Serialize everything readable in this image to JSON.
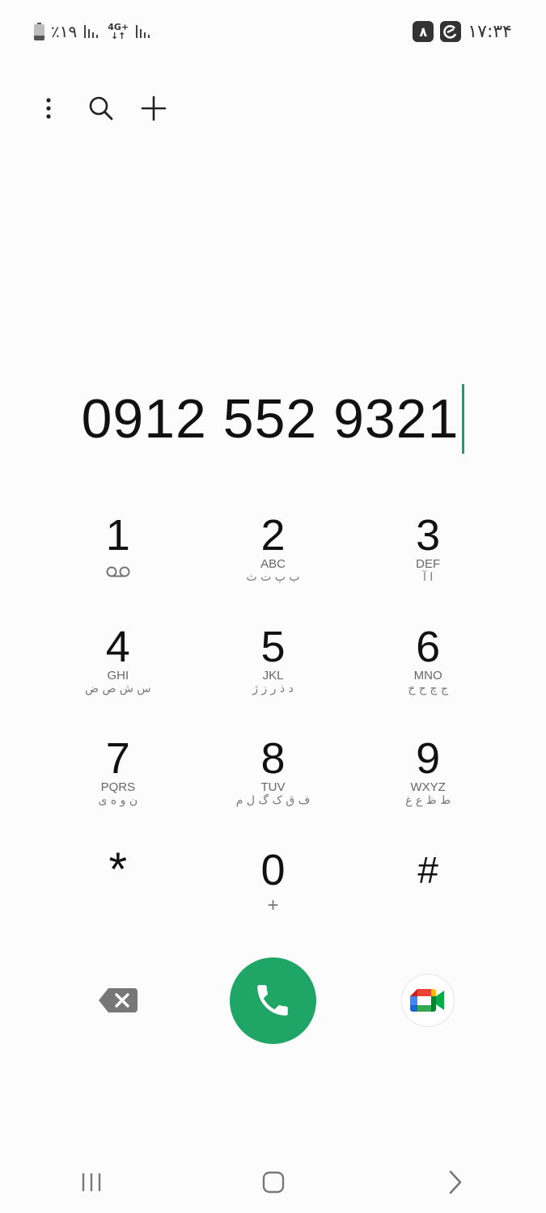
{
  "status_bar": {
    "battery_percent": "٪۱۹",
    "network_type": "4G+",
    "time": "۱۷:۳۴",
    "notification_count": "۸"
  },
  "dialer": {
    "number": "0912 552 9321",
    "keys": [
      {
        "digit": "1",
        "letters": "",
        "persian": ""
      },
      {
        "digit": "2",
        "letters": "ABC",
        "persian": "ب پ ت ث"
      },
      {
        "digit": "3",
        "letters": "DEF",
        "persian": "ا آ"
      },
      {
        "digit": "4",
        "letters": "GHI",
        "persian": "س ش ص ض"
      },
      {
        "digit": "5",
        "letters": "JKL",
        "persian": "د ذ ر ز ژ"
      },
      {
        "digit": "6",
        "letters": "MNO",
        "persian": "ج چ ح خ"
      },
      {
        "digit": "7",
        "letters": "PQRS",
        "persian": "ن و ه ی"
      },
      {
        "digit": "8",
        "letters": "TUV",
        "persian": "ف ق ک گ ل م"
      },
      {
        "digit": "9",
        "letters": "WXYZ",
        "persian": "ط ظ ع غ"
      },
      {
        "digit": "*",
        "letters": "",
        "persian": ""
      },
      {
        "digit": "0",
        "letters": "",
        "persian": "",
        "sub": "+"
      },
      {
        "digit": "#",
        "letters": "",
        "persian": ""
      }
    ]
  },
  "icons": {
    "more": "more-vert-icon",
    "search": "search-icon",
    "add": "plus-icon",
    "voicemail": "voicemail-icon",
    "backspace": "backspace-icon",
    "call": "phone-icon",
    "video": "google-meet-icon"
  },
  "colors": {
    "call_green": "#1fa565",
    "cursor_green": "#1e9e6a",
    "background": "#fcfcfc"
  }
}
